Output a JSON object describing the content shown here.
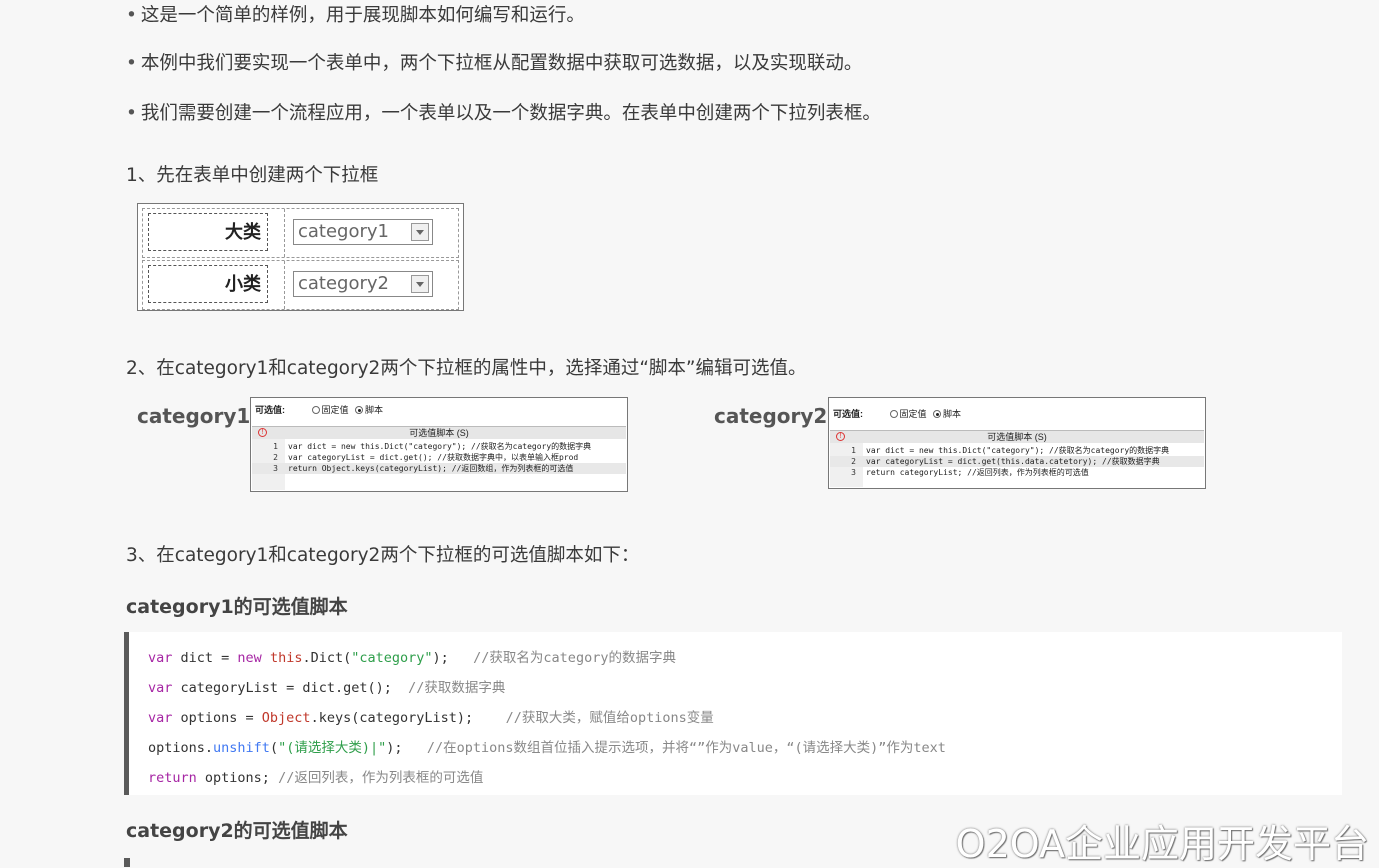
{
  "bullets": [
    "这是一个简单的样例，用于展现脚本如何编写和运行。",
    "本例中我们要实现一个表单中，两个下拉框从配置数据中获取可选数据，以及实现联动。",
    "我们需要创建一个流程应用，一个表单以及一个数据字典。在表单中创建两个下拉列表框。"
  ],
  "bullet_marker": "•",
  "steps": {
    "step1": "1、先在表单中创建两个下拉框",
    "step2": "2、在category1和category2两个下拉框的属性中，选择通过“脚本”编辑可选值。",
    "step3": "3、在category1和category2两个下拉框的可选值脚本如下："
  },
  "form": {
    "rows": [
      {
        "label": "大类",
        "select_value": "category1"
      },
      {
        "label": "小类",
        "select_value": "category2"
      }
    ]
  },
  "panels": {
    "left": {
      "title": "category1",
      "options_label": "可选值:",
      "radio_fixed": "固定值",
      "radio_script": "脚本",
      "bar_title": "可选值脚本 (S)",
      "lines": [
        {
          "n": "1",
          "text": "var dict = new this.Dict(\"category\"); //获取名为category的数据字典"
        },
        {
          "n": "2",
          "text": "var categoryList = dict.get(); //获取数据字典中，以表单输入框prod"
        },
        {
          "n": "3",
          "text": "return Object.keys(categoryList); //返回数组，作为列表框的可选值"
        }
      ]
    },
    "right": {
      "title": "category2",
      "options_label": "可选值:",
      "radio_fixed": "固定值",
      "radio_script": "脚本",
      "bar_title": "可选值脚本 (S)",
      "lines": [
        {
          "n": "1",
          "text": "var dict = new this.Dict(\"category\"); //获取名为category的数据字典"
        },
        {
          "n": "2",
          "text": "var categoryList = dict.get(this.data.catetory); //获取数据字典"
        },
        {
          "n": "3",
          "text": "return categoryList; //返回列表，作为列表框的可选值"
        }
      ]
    }
  },
  "section1_heading": "category1的可选值脚本",
  "section2_heading": "category2的可选值脚本",
  "code": {
    "l1": {
      "a": "var",
      "b": " dict = ",
      "c": "new",
      "d": " ",
      "e": "this",
      "f": ".Dict(",
      "g": "\"category\"",
      "h": ");   ",
      "i": "//获取名为category的数据字典"
    },
    "l2": {
      "a": "var",
      "b": " categoryList = dict.get();  ",
      "c": "//获取数据字典"
    },
    "l3": {
      "a": "var",
      "b": " options = ",
      "c": "Object",
      "d": ".keys(categoryList);    ",
      "e": "//获取大类，赋值给options变量"
    },
    "l4": {
      "a": "options.",
      "b": "unshift",
      "c": "(",
      "d": "\"(请选择大类)|\"",
      "e": ");   ",
      "f": "//在options数组首位插入提示选项，并将“”作为value，“(请选择大类)”作为text"
    },
    "l5": {
      "a": "return",
      "b": " options; ",
      "c": "//返回列表，作为列表框的可选值"
    }
  },
  "watermark": "O2OA企业应用开发平台"
}
